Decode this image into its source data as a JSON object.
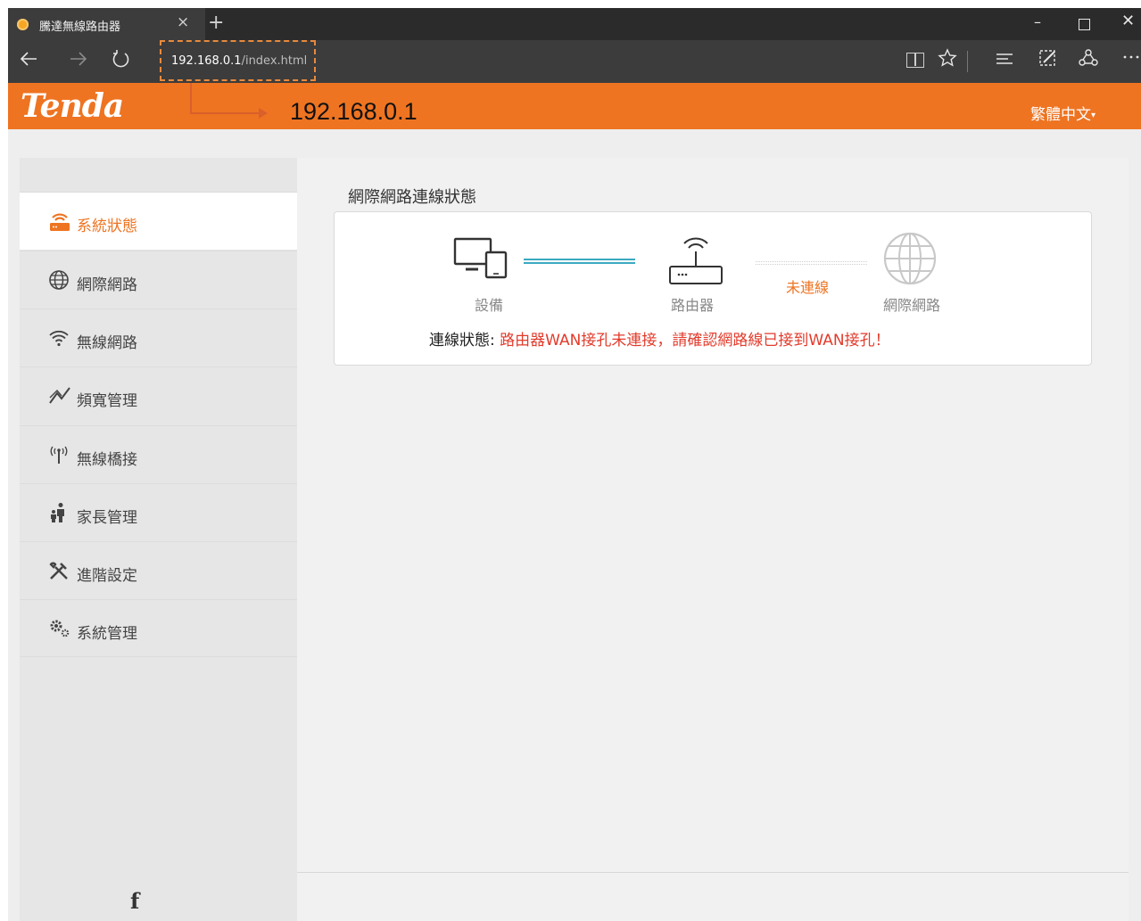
{
  "browser": {
    "tab_title": "騰達無線路由器",
    "tab_close": "×",
    "new_tab": "+",
    "window_controls": {
      "minimize": "–",
      "close": "✕"
    },
    "url_host": "192.168.0.1",
    "url_path": "/index.html",
    "icons": [
      "back-icon",
      "forward-icon",
      "refresh-icon",
      "reading-view-icon",
      "favorite-star-icon",
      "hub-icon",
      "web-note-icon",
      "share-icon",
      "more-icon"
    ]
  },
  "header": {
    "logo": "Tenda",
    "language": "繁體中文",
    "language_caret": "▾",
    "color": "#ee7422"
  },
  "annotation": {
    "label": "192.168.0.1"
  },
  "sidebar": {
    "items": [
      {
        "label": "系統狀態",
        "icon": "router-status-icon",
        "active": true
      },
      {
        "label": "網際網路",
        "icon": "globe-icon"
      },
      {
        "label": "無線網路",
        "icon": "wifi-icon"
      },
      {
        "label": "頻寬管理",
        "icon": "bandwidth-icon"
      },
      {
        "label": "無線橋接",
        "icon": "antenna-icon"
      },
      {
        "label": "家長管理",
        "icon": "parent-child-icon"
      },
      {
        "label": "進階設定",
        "icon": "tools-icon"
      },
      {
        "label": "系統管理",
        "icon": "gears-icon"
      }
    ],
    "footer_icon": "facebook-icon",
    "footer_text": "f"
  },
  "main": {
    "title": "網際網路連線狀態",
    "topology": {
      "device_label": "設備",
      "router_label": "路由器",
      "internet_label": "網際網路",
      "link_status": "未連線"
    },
    "status_prefix": "連線狀態: ",
    "status_message": "路由器WAN接孔未連接，請確認網路線已接到WAN接孔！",
    "colors": {
      "ok_line": "#3ba9c0",
      "error_text": "#e23b2b",
      "accent": "#ee7422"
    }
  }
}
